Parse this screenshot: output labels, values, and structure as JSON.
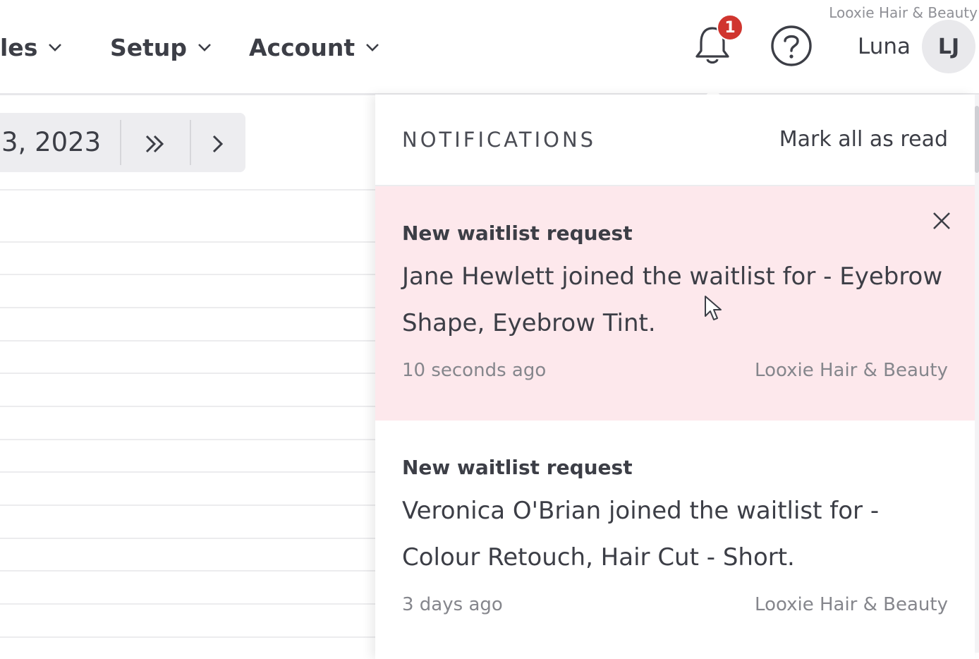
{
  "nav": {
    "items": [
      {
        "label": "les"
      },
      {
        "label": "Setup"
      },
      {
        "label": "Account"
      }
    ]
  },
  "header": {
    "business_name": "Looxie Hair & Beauty",
    "notification_count": "1",
    "user_name": "Luna",
    "user_initials": "LJ"
  },
  "calendar": {
    "date_label": "3, 2023"
  },
  "notifications": {
    "title": "NOTIFICATIONS",
    "mark_all_label": "Mark all as read",
    "items": [
      {
        "title": "New waitlist request",
        "body": "Jane Hewlett joined the waitlist for - Eyebrow Shape, Eyebrow Tint.",
        "time": "10 seconds ago",
        "business": "Looxie Hair & Beauty",
        "unread": true
      },
      {
        "title": "New waitlist request",
        "body": "Veronica O'Brian joined the waitlist for - Colour Retouch, Hair Cut - Short.",
        "time": "3 days ago",
        "business": "Looxie Hair & Beauty",
        "unread": false
      }
    ]
  },
  "colors": {
    "badge": "#d0352f",
    "unread_bg": "#fde8ec",
    "text": "#3c3e46",
    "muted": "#85868c"
  }
}
